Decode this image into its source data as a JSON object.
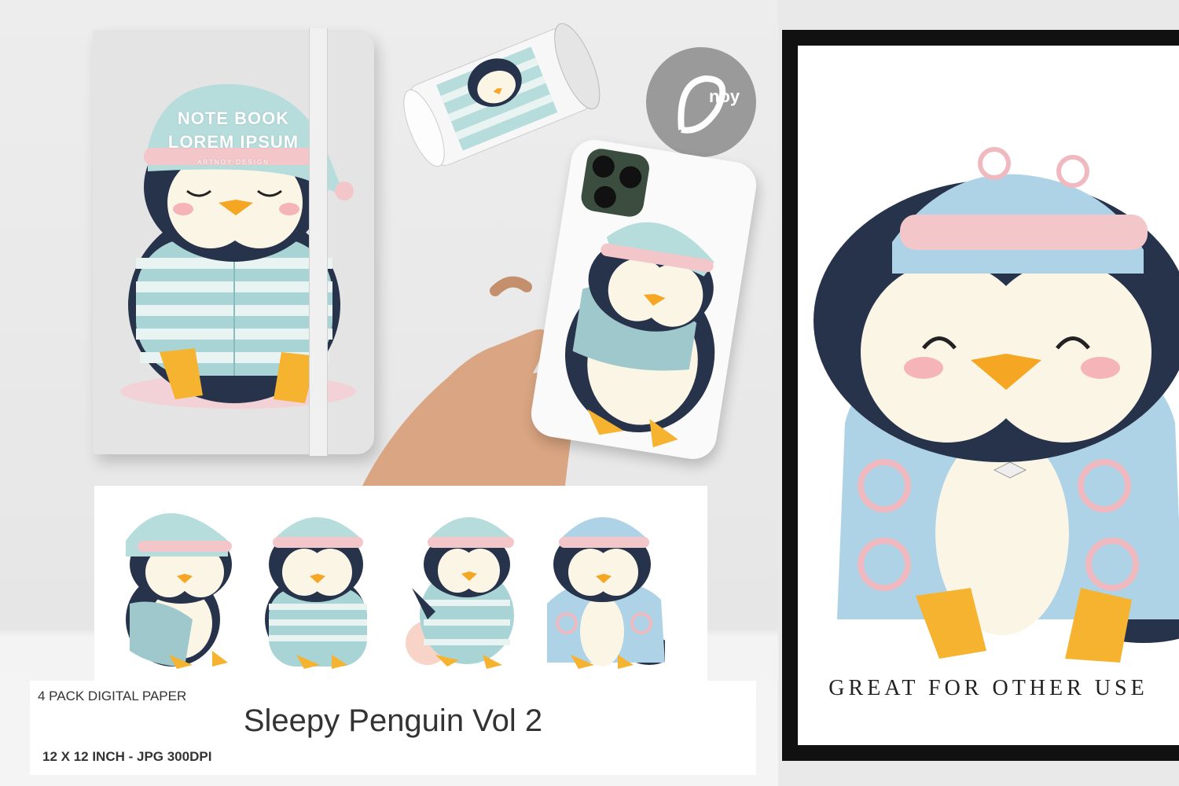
{
  "notebook": {
    "title_line1": "NOTE BOOK",
    "title_line2": "LOREM IPSUM",
    "credit": "ARTNOY DESIGN"
  },
  "logo": {
    "text": "noy"
  },
  "poster": {
    "caption": "GREAT FOR OTHER USE"
  },
  "banner": {
    "pack_label": "4 PACK DIGITAL PAPER",
    "product_name": "Sleepy Penguin Vol 2",
    "size_label": "12 X 12 INCH - JPG 300DPI"
  },
  "colors": {
    "penguin_body": "#27334a",
    "penguin_belly": "#fbf5e6",
    "beak": "#f5a623",
    "pajama_blue": "#a9d4d6",
    "pajama_stripe": "#e9f4f2",
    "hat_pink": "#f3c6c9",
    "frame": "#111111"
  }
}
